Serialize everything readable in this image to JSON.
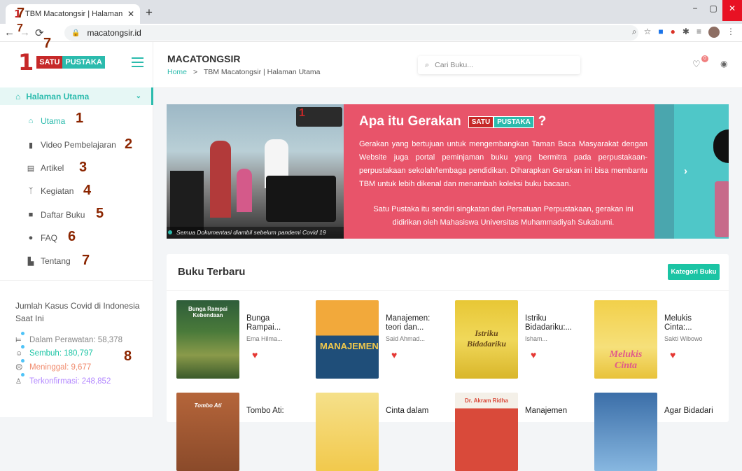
{
  "browser": {
    "tab_title": "TBM Macatongsir | Halaman Uta",
    "tab_close": "✕",
    "new_tab": "+",
    "url": "macatongsir.id",
    "win_min": "−",
    "win_max": "▢",
    "win_close": "✕"
  },
  "annotations": [
    "1",
    "2",
    "3",
    "4",
    "5",
    "6",
    "7",
    "7",
    "7",
    "8"
  ],
  "logo": {
    "one": "1",
    "satu": "SATU",
    "pustaka": "PUSTAKA"
  },
  "sidebar": {
    "group_label": "Halaman Utama",
    "items": [
      {
        "label": "Utama",
        "icon": "home-icon"
      },
      {
        "label": "Video Pembelajaran",
        "icon": "film-icon"
      },
      {
        "label": "Artikel",
        "icon": "article-icon"
      },
      {
        "label": "Kegiatan",
        "icon": "activity-icon"
      },
      {
        "label": "Daftar Buku",
        "icon": "book-icon"
      },
      {
        "label": "FAQ",
        "icon": "question-icon"
      },
      {
        "label": "Tentang",
        "icon": "building-icon"
      }
    ],
    "covid_title": "Jumlah Kasus Covid di Indonesia Saat Ini",
    "covid": [
      {
        "label": "Dalam Perawatan: 58,378",
        "color": "#888888"
      },
      {
        "label": "Sembuh: 180,797",
        "color": "#1bc4a4"
      },
      {
        "label": "Meninggal: 9,677",
        "color": "#f08a6c"
      },
      {
        "label": "Terkonfirmasi: 248,852",
        "color": "#b388ff"
      }
    ]
  },
  "header": {
    "site_title": "MACATONGSIR",
    "breadcrumb_home": "Home",
    "breadcrumb_sep": ">",
    "breadcrumb_current": "TBM Macatongsir | Halaman Utama",
    "search_placeholder": "Cari Buku...",
    "wishlist_count": "0"
  },
  "banner": {
    "caption": "Semua Dokumentasi diambil sebelum pandemi Covid 19",
    "headline_prefix": "Apa itu Gerakan",
    "headline_tag_satu": "SATU",
    "headline_tag_pustaka": "PUSTAKA",
    "headline_suffix": "?",
    "paragraph1": "Gerakan yang bertujuan untuk mengembangkan Taman Baca Masyarakat dengan Website juga portal peminjaman buku yang bermitra pada perpustakaan-perpustakaan sekolah/lembaga pendidikan. Diharapkan Gerakan ini bisa membantu TBM untuk lebih dikenal dan menambah koleksi buku bacaan.",
    "paragraph2": "Satu Pustaka itu sendiri singkatan dari Persatuan Perpustakaan, gerakan ini didirikan oleh Mahasiswa Universitas Muhammadiyah Sukabumi.",
    "next_arrow": "›"
  },
  "books_section": {
    "title": "Buku Terbaru",
    "kategori_label": "Kategori Buku",
    "books": [
      {
        "title": "Bunga Rampai...",
        "author": "Ema Hilma...",
        "cover_color": "#2e5d3a",
        "cover_text": "Bunga Rampai Kebendaan"
      },
      {
        "title": "Manajemen: teori dan...",
        "author": "Said Ahmad...",
        "cover_color": "#1f4e79",
        "cover_text": "MANAJEMEN"
      },
      {
        "title": "Istriku Bidadariku:...",
        "author": "Isham...",
        "cover_color": "#e6c229",
        "cover_text": "Istriku Bidadariku"
      },
      {
        "title": "Melukis Cinta:...",
        "author": "Sakti Wibowo",
        "cover_color": "#e6c229",
        "cover_text": "Melukis Cinta"
      },
      {
        "title": "Tombo Ati:",
        "author": "",
        "cover_color": "#a0522d",
        "cover_text": "Tombo Ati"
      },
      {
        "title": "Cinta dalam",
        "author": "",
        "cover_color": "#f0d060",
        "cover_text": ""
      },
      {
        "title": "Manajemen",
        "author": "",
        "cover_color": "#d94a3a",
        "cover_text": "Dr. Akram Ridha"
      },
      {
        "title": "Agar Bidadari",
        "author": "",
        "cover_color": "#3b6ea8",
        "cover_text": ""
      }
    ]
  }
}
